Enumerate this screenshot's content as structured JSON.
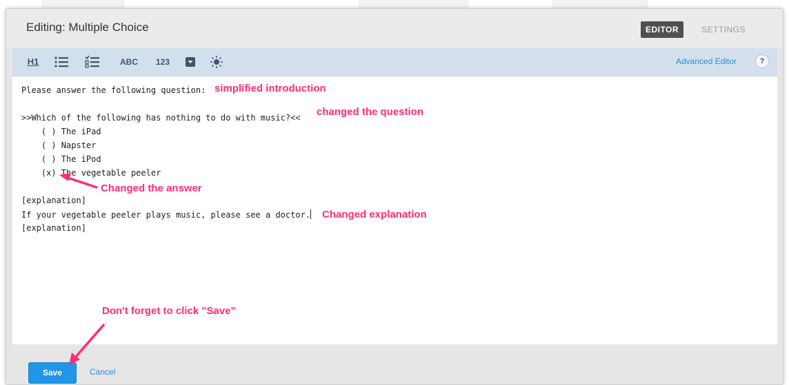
{
  "window": {
    "title": "Editing: Multiple Choice"
  },
  "modes": {
    "editor": "EDITOR",
    "settings": "SETTINGS"
  },
  "toolbar": {
    "heading_label": "H1",
    "abc_label": "ABC",
    "num_label": "123",
    "advanced_editor": "Advanced Editor",
    "help": "?",
    "icons": [
      "heading-icon",
      "bulleted-list-icon",
      "checklist-icon",
      "text-input-icon",
      "numeric-input-icon",
      "dropdown-icon",
      "hint-lightbulb-icon"
    ]
  },
  "editor": {
    "lines": [
      "Please answer the following question:",
      ">>Which of the following has nothing to do with music?<<",
      "    ( ) The iPad",
      "    ( ) Napster",
      "    ( ) The iPod",
      "    (x) The vegetable peeler",
      "[explanation]",
      "If your vegetable peeler plays music, please see a doctor.",
      "[explanation]"
    ]
  },
  "annotations": {
    "intro": "simplified introduction",
    "question": "changed the question",
    "answer": "Changed the answer",
    "explanation": "Changed explanation",
    "save_reminder": "Don't forget to click \"Save\"",
    "color": "#ff2d78"
  },
  "footer": {
    "save": "Save",
    "cancel": "Cancel"
  },
  "colors": {
    "accent": "#2196e8",
    "toolbar_bg": "#d3e0ec",
    "active_tab": "#505050"
  }
}
